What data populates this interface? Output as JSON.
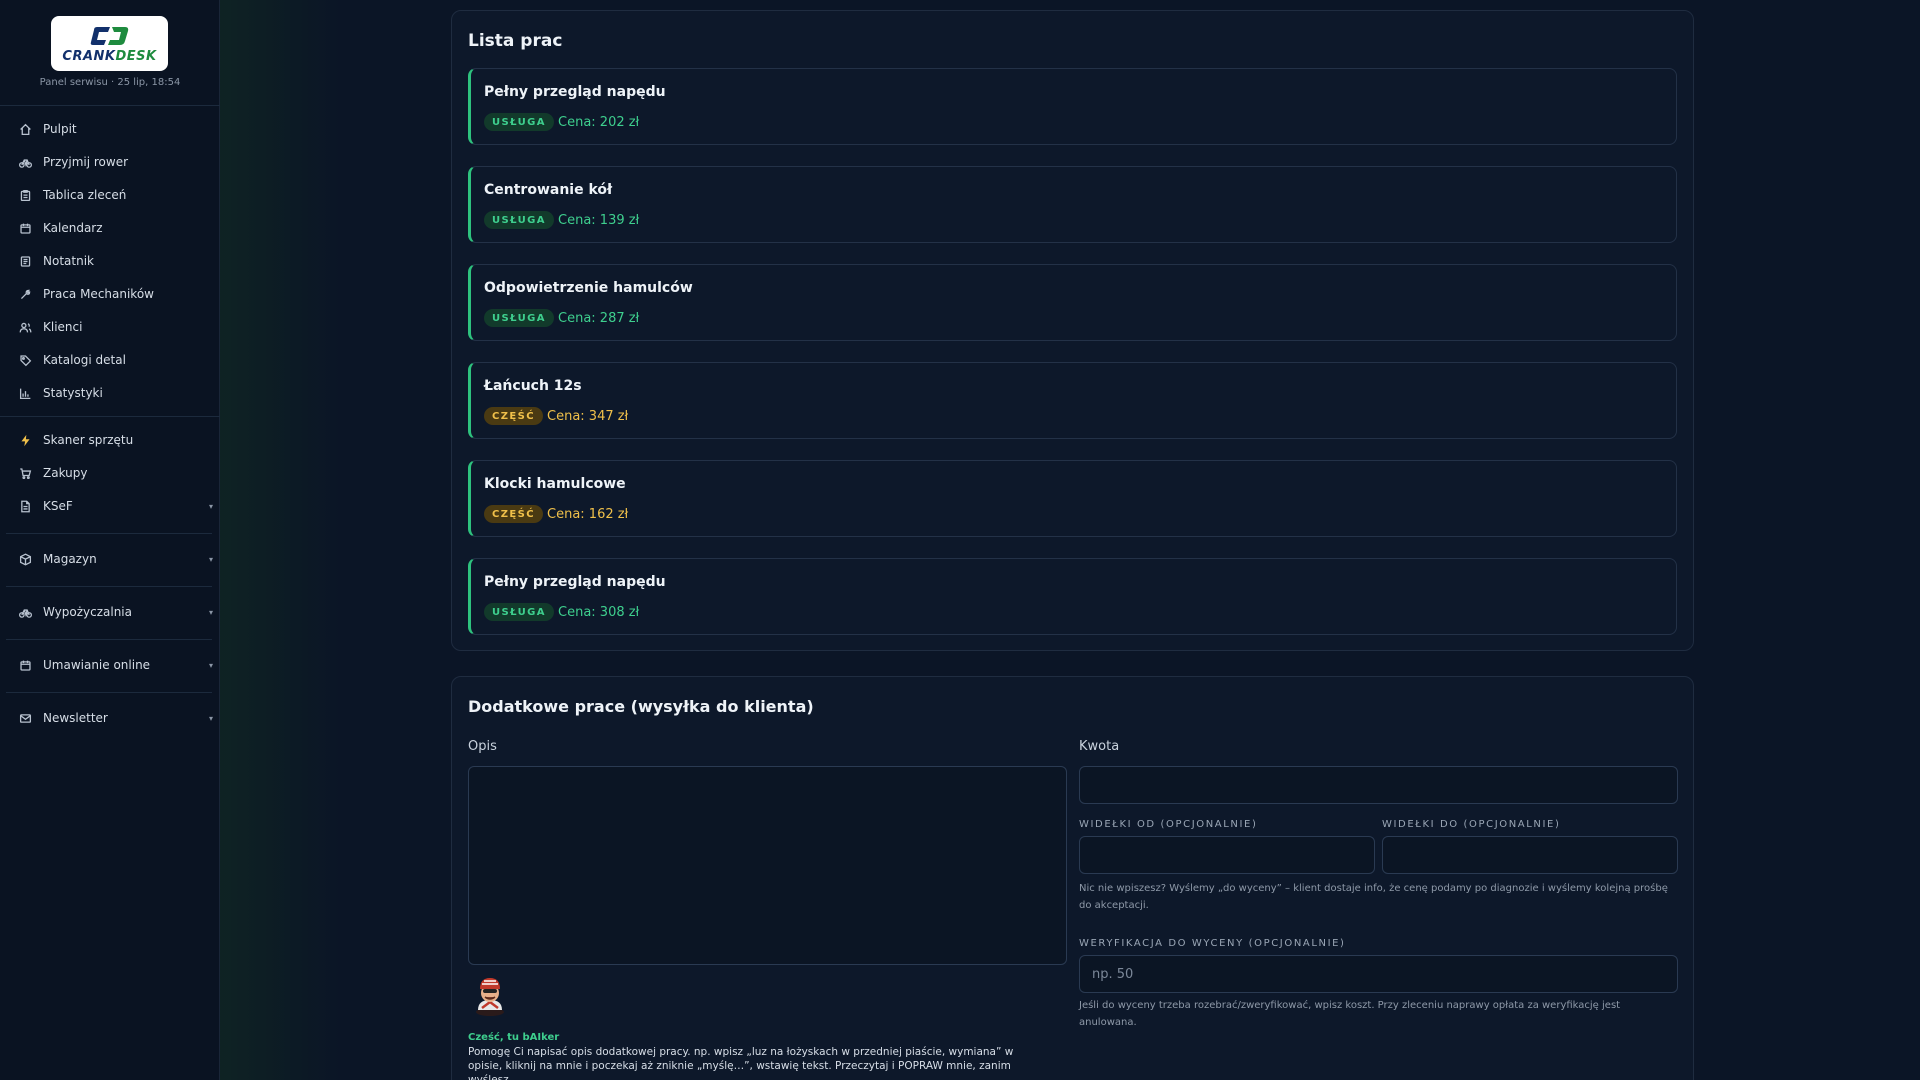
{
  "sidebar": {
    "logo_text_a": "CRANK",
    "logo_text_b": "DESK",
    "panel_sub": "Panel serwisu · 25 lip, 18:54",
    "items": [
      {
        "label": "Pulpit",
        "icon": "home-icon"
      },
      {
        "label": "Przyjmij rower",
        "icon": "bike-icon"
      },
      {
        "label": "Tablica zleceń",
        "icon": "clipboard-icon"
      },
      {
        "label": "Kalendarz",
        "icon": "calendar-icon"
      },
      {
        "label": "Notatnik",
        "icon": "notebook-icon"
      },
      {
        "label": "Praca Mechaników",
        "icon": "wrench-icon"
      },
      {
        "label": "Klienci",
        "icon": "users-icon"
      },
      {
        "label": "Katalogi detal",
        "icon": "tag-icon"
      },
      {
        "label": "Statystyki",
        "icon": "bar-chart-icon"
      }
    ],
    "items2": [
      {
        "label": "Skaner sprzętu",
        "icon": "lightning-icon"
      },
      {
        "label": "Zakupy",
        "icon": "cart-icon"
      },
      {
        "label": "KSeF",
        "icon": "document-icon"
      }
    ],
    "groups": [
      {
        "label": "Magazyn",
        "icon": "box-icon"
      },
      {
        "label": "Wypożyczalnia",
        "icon": "bike-icon"
      },
      {
        "label": "Umawianie online",
        "icon": "calendar-icon"
      },
      {
        "label": "Newsletter",
        "icon": "mail-icon"
      }
    ],
    "caret": "▾"
  },
  "work_list": {
    "title": "Lista prac",
    "items": [
      {
        "name": "Pełny przegląd napędu",
        "type": "USŁUGA",
        "price": "Cena: 202 zł"
      },
      {
        "name": "Centrowanie kół",
        "type": "USŁUGA",
        "price": "Cena: 139 zł"
      },
      {
        "name": "Odpowietrzenie hamulców",
        "type": "USŁUGA",
        "price": "Cena: 287 zł"
      },
      {
        "name": "Łańcuch 12s",
        "type": "CZĘŚĆ",
        "price": "Cena: 347 zł"
      },
      {
        "name": "Klocki hamulcowe",
        "type": "CZĘŚĆ",
        "price": "Cena: 162 zł"
      },
      {
        "name": "Pełny przegląd napędu",
        "type": "USŁUGA",
        "price": "Cena: 308 zł"
      }
    ]
  },
  "extra_work": {
    "title": "Dodatkowe prace (wysyłka do klienta)",
    "desc_label": "Opis",
    "desc_value": "",
    "amount_label": "Kwota",
    "amount_value": "",
    "range_from_label": "WIDEŁKI OD (OPCJONALNIE)",
    "range_to_label": "WIDEŁKI DO (OPCJONALNIE)",
    "range_hint": "Nic nie wpiszesz? Wyślemy „do wyceny” – klient dostaje info, że cenę podamy po diagnozie i wyślemy kolejną prośbę do akceptacji.",
    "verify_label": "WERYFIKACJA DO WYCENY (OPCJONALNIE)",
    "verify_placeholder": "np. 50",
    "verify_hint": "Jeśli do wyceny trzeba rozebrać/zweryfikować, wpisz koszt. Przy zleceniu naprawy opłata za weryfikację jest anulowana.",
    "bot_title": "Cześć, tu bAIker",
    "bot_text": "Pomogę Ci napisać opis dodatkowej pracy. np. wpisz „luz na łożyskach w przedniej piaście, wymiana” w opisie, kliknij na mnie i poczekaj aż zniknie „myślę…”, wstawię tekst. Przeczytaj i POPRAW mnie, zanim wyślesz."
  },
  "colors": {
    "accent_green": "#3ecf8e",
    "part_yellow": "#f0c04a",
    "background": "#0b1526"
  }
}
